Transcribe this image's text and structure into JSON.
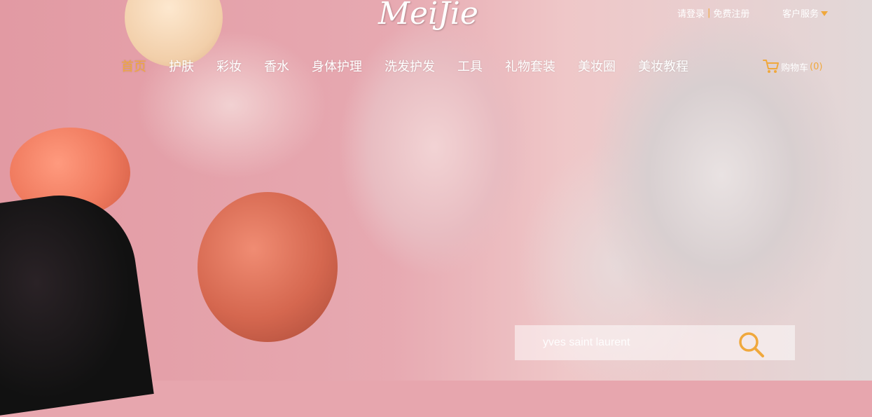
{
  "brand": {
    "logo": "MeiJie"
  },
  "top_links": {
    "login": "请登录",
    "separator": "|",
    "register": "免费注册",
    "service": "客户服务"
  },
  "nav": {
    "items": [
      {
        "label": "首页",
        "active": true
      },
      {
        "label": "护肤"
      },
      {
        "label": "彩妆"
      },
      {
        "label": "香水"
      },
      {
        "label": "身体护理"
      },
      {
        "label": "洗发护发"
      },
      {
        "label": "工具"
      },
      {
        "label": "礼物套装"
      },
      {
        "label": "美妆圈"
      },
      {
        "label": "美妆教程"
      }
    ]
  },
  "cart": {
    "label": "购物车",
    "count": "(0)"
  },
  "search": {
    "placeholder": "yves saint laurent"
  },
  "colors": {
    "accent": "#f0a83c",
    "text": "#ffffff"
  },
  "icons": {
    "cart": "shopping-cart-icon",
    "search": "search-icon",
    "dropdown": "caret-down-icon"
  }
}
